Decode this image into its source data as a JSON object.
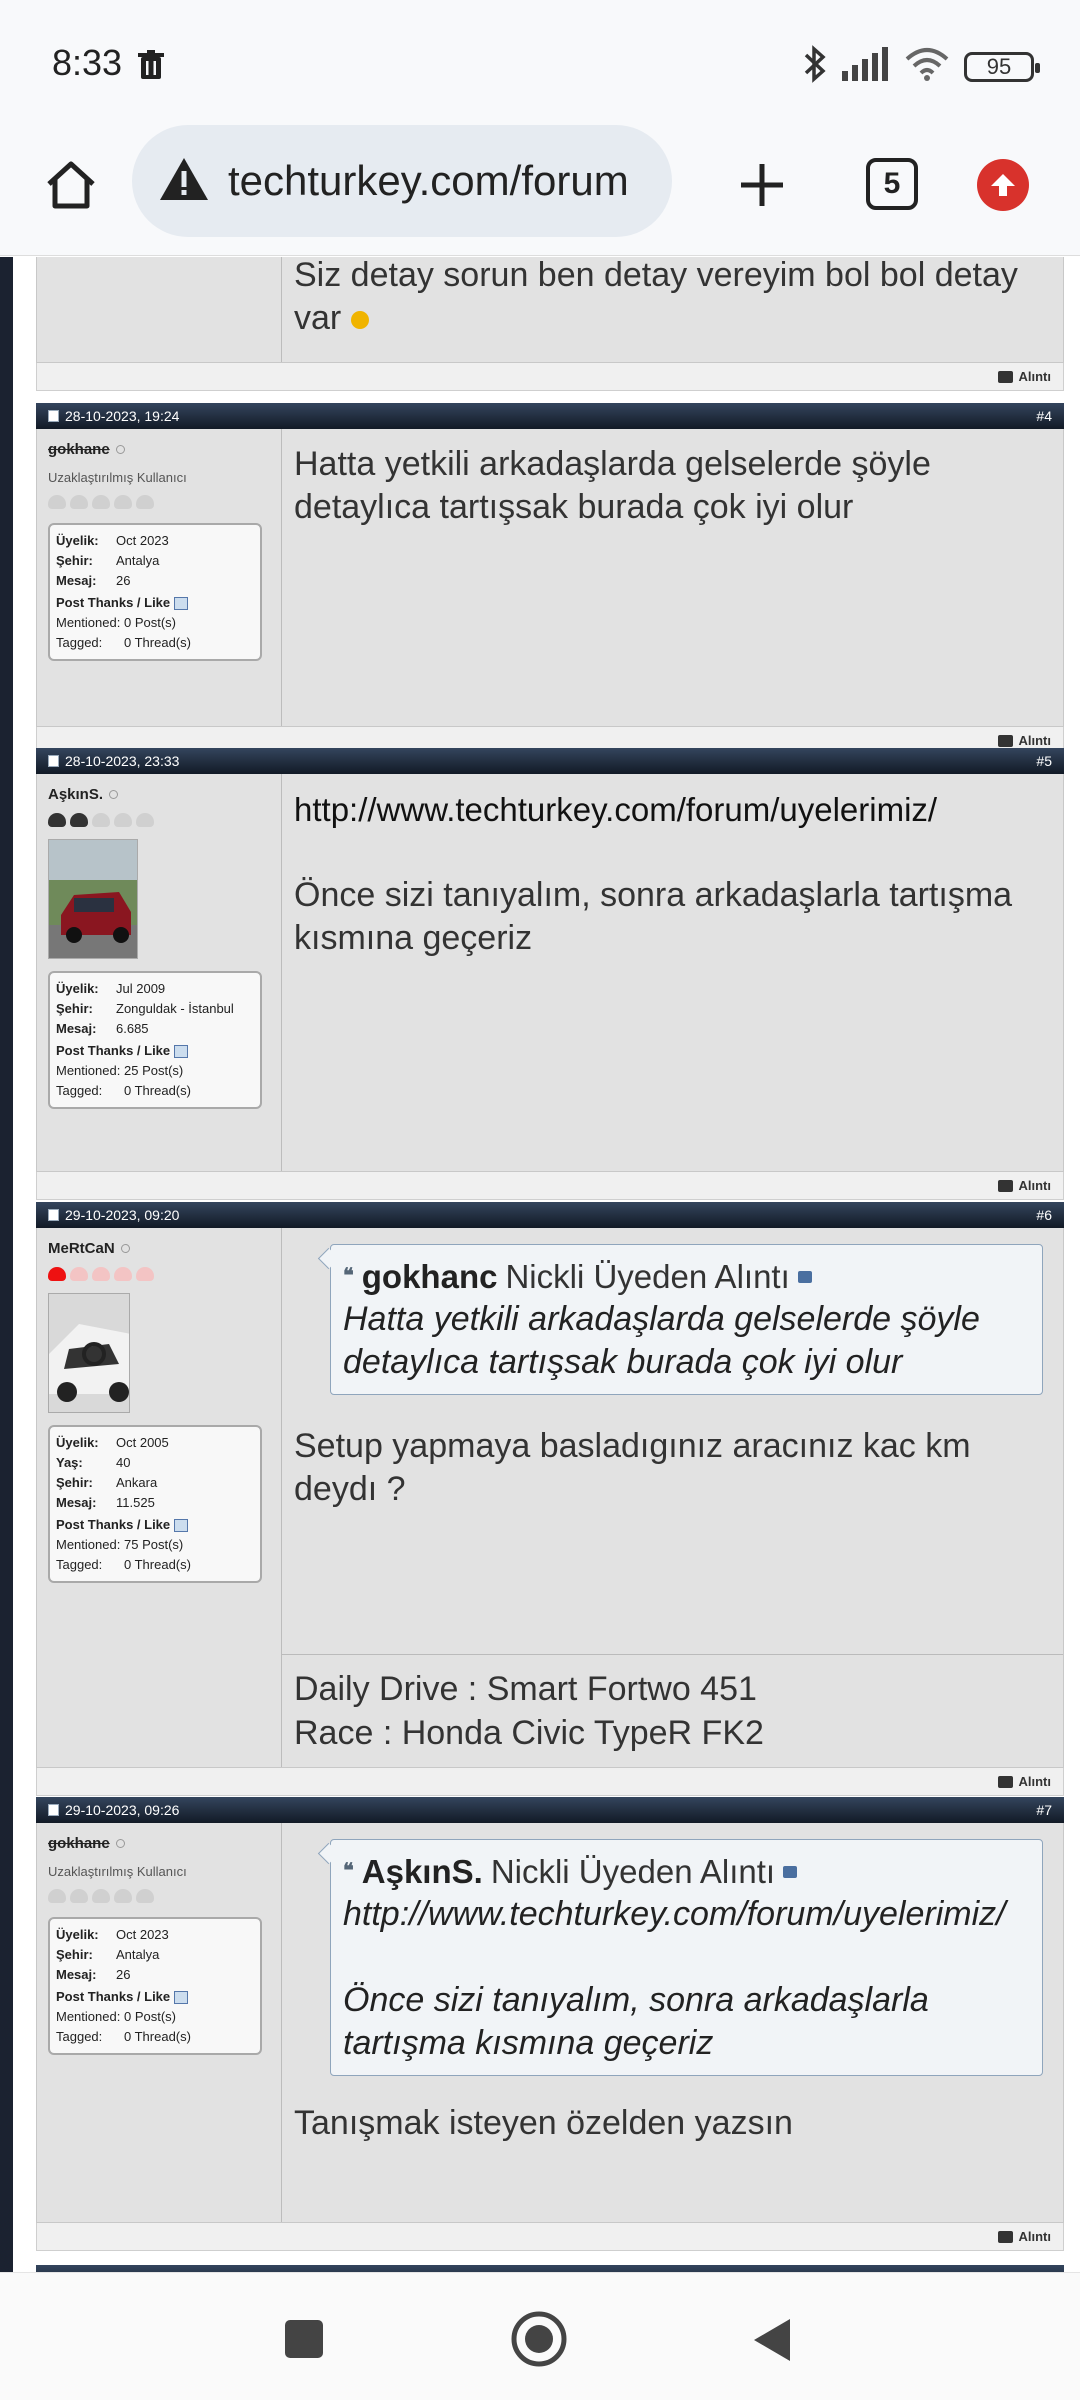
{
  "status": {
    "time": "8:33",
    "battery": "95"
  },
  "browser": {
    "url": "techturkey.com/forum",
    "tab_count": "5"
  },
  "top_post": {
    "text": "Siz detay sorun ben detay vereyim bol bol detay var",
    "quote_label": "Alıntı"
  },
  "posts": [
    {
      "date": "28-10-2023, 19:24",
      "number": "#4",
      "username": "gokhane",
      "user_title": "Uzaklaştırılmış Kullanıcı",
      "info": [
        {
          "k": "Üyelik:",
          "v": "Oct 2023"
        },
        {
          "k": "Şehir:",
          "v": "Antalya"
        },
        {
          "k": "Mesaj:",
          "v": "26"
        }
      ],
      "thanks_label": "Post Thanks / Like",
      "mentioned": {
        "k": "Mentioned:",
        "v": "0 Post(s)"
      },
      "tagged": {
        "k": "Tagged:",
        "v": "0 Thread(s)"
      },
      "message": "Hatta yetkili arkadaşlarda gelselerde şöyle detaylıca tartışsak burada çok iyi olur",
      "quote_label": "Alıntı"
    },
    {
      "date": "28-10-2023, 23:33",
      "number": "#5",
      "username": "AşkınS.",
      "info": [
        {
          "k": "Üyelik:",
          "v": "Jul 2009"
        },
        {
          "k": "Şehir:",
          "v": "Zonguldak - İstanbul"
        },
        {
          "k": "Mesaj:",
          "v": "6.685"
        }
      ],
      "thanks_label": "Post Thanks / Like",
      "mentioned": {
        "k": "Mentioned:",
        "v": "25 Post(s)"
      },
      "tagged": {
        "k": "Tagged:",
        "v": "0 Thread(s)"
      },
      "message_link": "http://www.techturkey.com/forum/uyelerimiz/",
      "message": "Önce sizi tanıyalım, sonra arkadaşlarla tartışma kısmına geçeriz",
      "quote_label": "Alıntı"
    },
    {
      "date": "29-10-2023, 09:20",
      "number": "#6",
      "username": "MeRtCaN",
      "info": [
        {
          "k": "Üyelik:",
          "v": "Oct 2005"
        },
        {
          "k": "Yaş:",
          "v": "40"
        },
        {
          "k": "Şehir:",
          "v": "Ankara"
        },
        {
          "k": "Mesaj:",
          "v": "11.525"
        }
      ],
      "thanks_label": "Post Thanks / Like",
      "mentioned": {
        "k": "Mentioned:",
        "v": "75 Post(s)"
      },
      "tagged": {
        "k": "Tagged:",
        "v": "0 Thread(s)"
      },
      "quote_author": "gokhanc",
      "quote_suffix": "Nickli Üyeden Alıntı",
      "quote_text": "Hatta yetkili arkadaşlarda gelselerde şöyle detaylıca tartışsak burada çok iyi olur",
      "message": "Setup yapmaya basladıgınız aracınız kac km deydı ?",
      "signature_line1": "Daily Drive : Smart Fortwo 451",
      "signature_line2": "Race : Honda Civic TypeR FK2",
      "quote_label": "Alıntı"
    },
    {
      "date": "29-10-2023, 09:26",
      "number": "#7",
      "username": "gokhane",
      "user_title": "Uzaklaştırılmış Kullanıcı",
      "info": [
        {
          "k": "Üyelik:",
          "v": "Oct 2023"
        },
        {
          "k": "Şehir:",
          "v": "Antalya"
        },
        {
          "k": "Mesaj:",
          "v": "26"
        }
      ],
      "thanks_label": "Post Thanks / Like",
      "mentioned": {
        "k": "Mentioned:",
        "v": "0 Post(s)"
      },
      "tagged": {
        "k": "Tagged:",
        "v": "0 Thread(s)"
      },
      "quote_author": "AşkınS.",
      "quote_suffix": "Nickli Üyeden Alıntı",
      "quote_link": "http://www.techturkey.com/forum/uyelerimiz/",
      "quote_text": "Önce sizi tanıyalım, sonra arkadaşlarla tartışma kısmına geçeriz",
      "message": "Tanışmak isteyen özelden yazsın",
      "quote_label": "Alıntı"
    }
  ]
}
